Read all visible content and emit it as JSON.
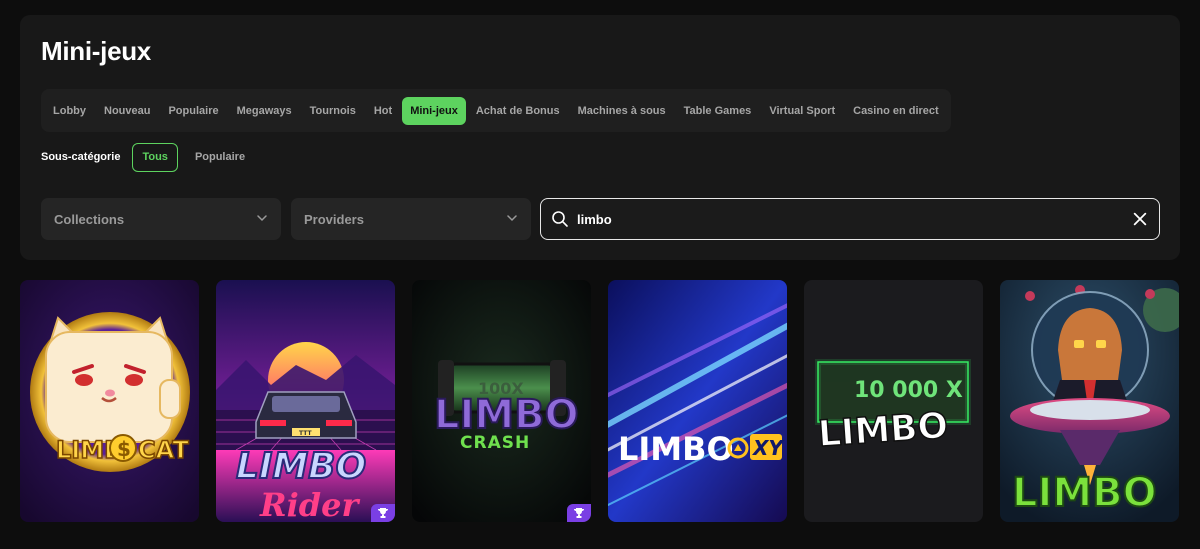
{
  "header": {
    "title": "Mini-jeux"
  },
  "tabs": [
    {
      "label": "Lobby"
    },
    {
      "label": "Nouveau"
    },
    {
      "label": "Populaire"
    },
    {
      "label": "Megaways"
    },
    {
      "label": "Tournois"
    },
    {
      "label": "Hot"
    },
    {
      "label": "Mini-jeux",
      "active": true
    },
    {
      "label": "Achat de Bonus"
    },
    {
      "label": "Machines à sous"
    },
    {
      "label": "Table Games"
    },
    {
      "label": "Virtual Sport"
    },
    {
      "label": "Casino en direct"
    }
  ],
  "subcategory": {
    "label": "Sous-catégorie",
    "options": [
      {
        "label": "Tous",
        "active": true
      },
      {
        "label": "Populaire"
      }
    ]
  },
  "filters": {
    "collections": "Collections",
    "providers": "Providers"
  },
  "search": {
    "value": "limbo",
    "icon": "search-icon",
    "clear_icon": "close-icon"
  },
  "games": [
    {
      "art_text": [
        "LIMB",
        "CAT"
      ],
      "art_text_b": "$",
      "tournament": false
    },
    {
      "art_text": [
        "LIMBO",
        "Rider"
      ],
      "plate": "TTT",
      "tournament": true
    },
    {
      "art_text": [
        "LIMBO",
        "CRASH"
      ],
      "art_text_b": "100X",
      "tournament": true
    },
    {
      "art_text": [
        "LIMBO",
        "XY"
      ],
      "tournament": false
    },
    {
      "art_text": [
        "10 000 X",
        "LIMBO"
      ],
      "tournament": false
    },
    {
      "art_text": [
        "LIMBO"
      ],
      "tournament": false
    }
  ],
  "colors": {
    "accent": "#5dd35f",
    "background": "#0d0d0d",
    "panel": "#181818",
    "trophy_badge": "#7a3fe4"
  }
}
